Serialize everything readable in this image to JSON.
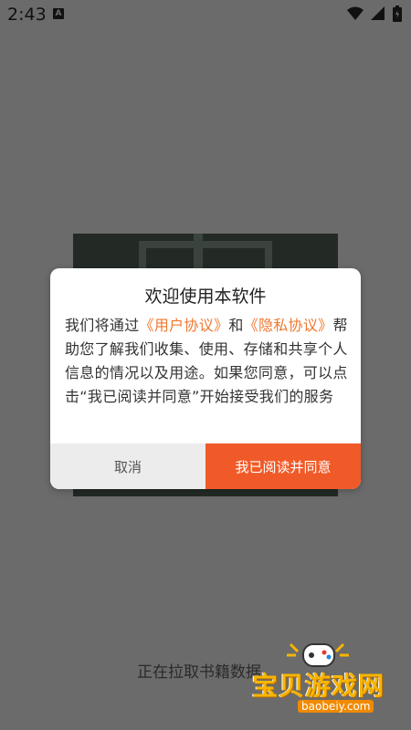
{
  "status_bar": {
    "time": "2:43",
    "notification_icon": "A",
    "icons": [
      "wifi-icon",
      "signal-icon",
      "battery-icon"
    ]
  },
  "dialog": {
    "title": "欢迎使用本软件",
    "body_prefix": "我们将通过",
    "user_agreement_link": "《用户协议》",
    "body_and": "和",
    "privacy_link": "《隐私协议》",
    "body_suffix": "帮助您了解我们收集、使用、存储和共享个人信息的情况以及用途。如果您同意，可以点击“我已阅读并同意”开始接受我们的服务",
    "cancel_label": "取消",
    "agree_label": "我已阅读并同意"
  },
  "loading_text": "正在拉取书籍数据",
  "watermark": {
    "text": "宝贝游戏网",
    "url": "baobeiy.com"
  },
  "colors": {
    "accent": "#f05a28",
    "link": "#f0782f",
    "overlay": "#6b6b6b"
  }
}
